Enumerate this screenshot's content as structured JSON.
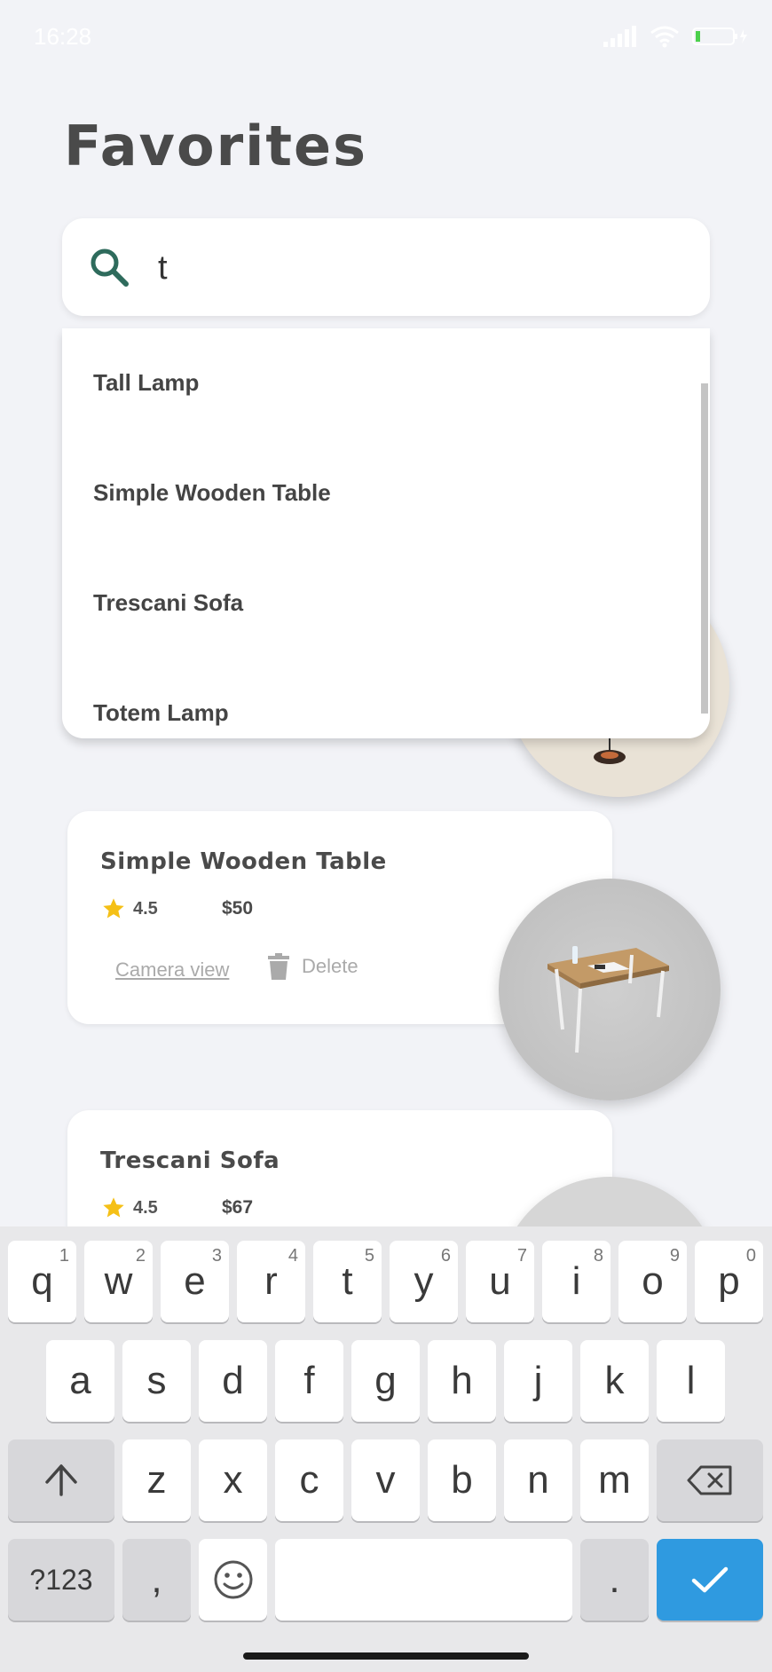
{
  "status_bar": {
    "time": "16:28"
  },
  "page": {
    "title": "Favorites"
  },
  "search": {
    "value": "t",
    "placeholder": ""
  },
  "suggestions": [
    "Tall Lamp",
    "Simple Wooden Table",
    "Trescani Sofa",
    "Totem Lamp"
  ],
  "products": [
    {
      "name": "Simple Wooden Table",
      "rating": "4.5",
      "price": "$50",
      "camera_label": "Camera view",
      "delete_label": "Delete"
    },
    {
      "name": "Trescani Sofa",
      "rating": "4.5",
      "price": "$67"
    }
  ],
  "keyboard": {
    "row1": [
      {
        "label": "q",
        "hint": "1"
      },
      {
        "label": "w",
        "hint": "2"
      },
      {
        "label": "e",
        "hint": "3"
      },
      {
        "label": "r",
        "hint": "4"
      },
      {
        "label": "t",
        "hint": "5"
      },
      {
        "label": "y",
        "hint": "6"
      },
      {
        "label": "u",
        "hint": "7"
      },
      {
        "label": "i",
        "hint": "8"
      },
      {
        "label": "o",
        "hint": "9"
      },
      {
        "label": "p",
        "hint": "0"
      }
    ],
    "row2": [
      "a",
      "s",
      "d",
      "f",
      "g",
      "h",
      "j",
      "k",
      "l"
    ],
    "row3": [
      "z",
      "x",
      "c",
      "v",
      "b",
      "n",
      "m"
    ],
    "symbols_label": "?123",
    "comma_label": ",",
    "period_label": "."
  },
  "colors": {
    "accent_green": "#2e6b5c",
    "star": "#f5c016",
    "keyboard_action": "#2f9ae0"
  }
}
